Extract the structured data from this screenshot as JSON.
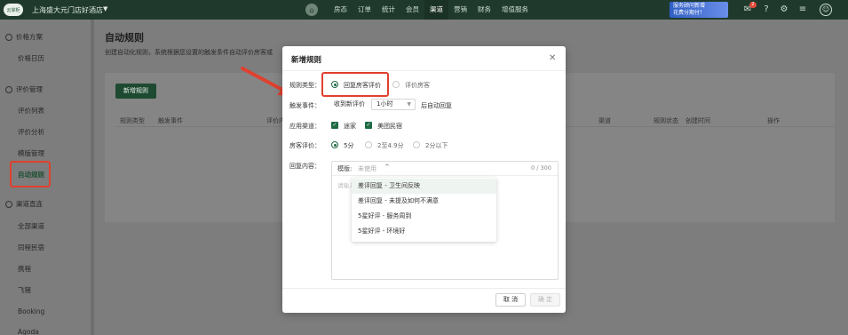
{
  "topbar": {
    "logo": "云掌柜",
    "hotel_name": "上海盛大元门店好酒店",
    "nav": [
      "房态",
      "订单",
      "统计",
      "会员",
      "渠道",
      "营销",
      "财务",
      "增值服务"
    ],
    "active_nav": "渠道",
    "promo_line1": "服务顾问新增",
    "promo_line2": "花费分期付！",
    "message_count": "2"
  },
  "sidebar": {
    "group_price": "价格方案",
    "price_items": [
      "价格日历"
    ],
    "group_review": "评价管理",
    "review_items": [
      "评价列表",
      "评价分析",
      "模版管理",
      "自动规则"
    ],
    "group_channel": "渠道直连",
    "channel_items": [
      "全部渠道",
      "同程民宿",
      "携程",
      "飞猪",
      "Booking",
      "Agoda"
    ]
  },
  "main": {
    "title": "自动规则",
    "description": "创建自动化规则，系统根据您设置的触发条件自动评价房客或",
    "add_button": "新增规则",
    "columns": [
      "规则类型",
      "触发事件",
      "评价内",
      "渠道",
      "规则状态",
      "创建时间",
      "操作"
    ]
  },
  "modal": {
    "title": "新增规则",
    "rule_type_label": "规则类型：",
    "rule_type_options": [
      "回复房客评价",
      "评价房客"
    ],
    "trigger_label": "触发事件：",
    "trigger_event": "收到新评价",
    "trigger_delay": "1小时",
    "trigger_suffix": "后自动回复",
    "channel_label": "应用渠道：",
    "channels": [
      "途家",
      "美团民宿"
    ],
    "rating_label": "房客评价：",
    "rating_options": [
      "5分",
      "2至4.9分",
      "2分以下"
    ],
    "content_label": "回复内容：",
    "template_label": "模版:",
    "template_value": "未使用",
    "char_count": "0 / 300",
    "placeholder": "请输入",
    "template_options": [
      "差评回复 - 卫生间反映",
      "差评回复 - 未提及如何不满意",
      "5星好评 - 服务周到",
      "5星好评 - 环境好"
    ],
    "cancel": "取 消",
    "confirm": "确 定"
  },
  "colors": {
    "brand_green": "#1f6a44",
    "highlight_red": "#e0402e",
    "topbar": "#1f3a2d"
  }
}
